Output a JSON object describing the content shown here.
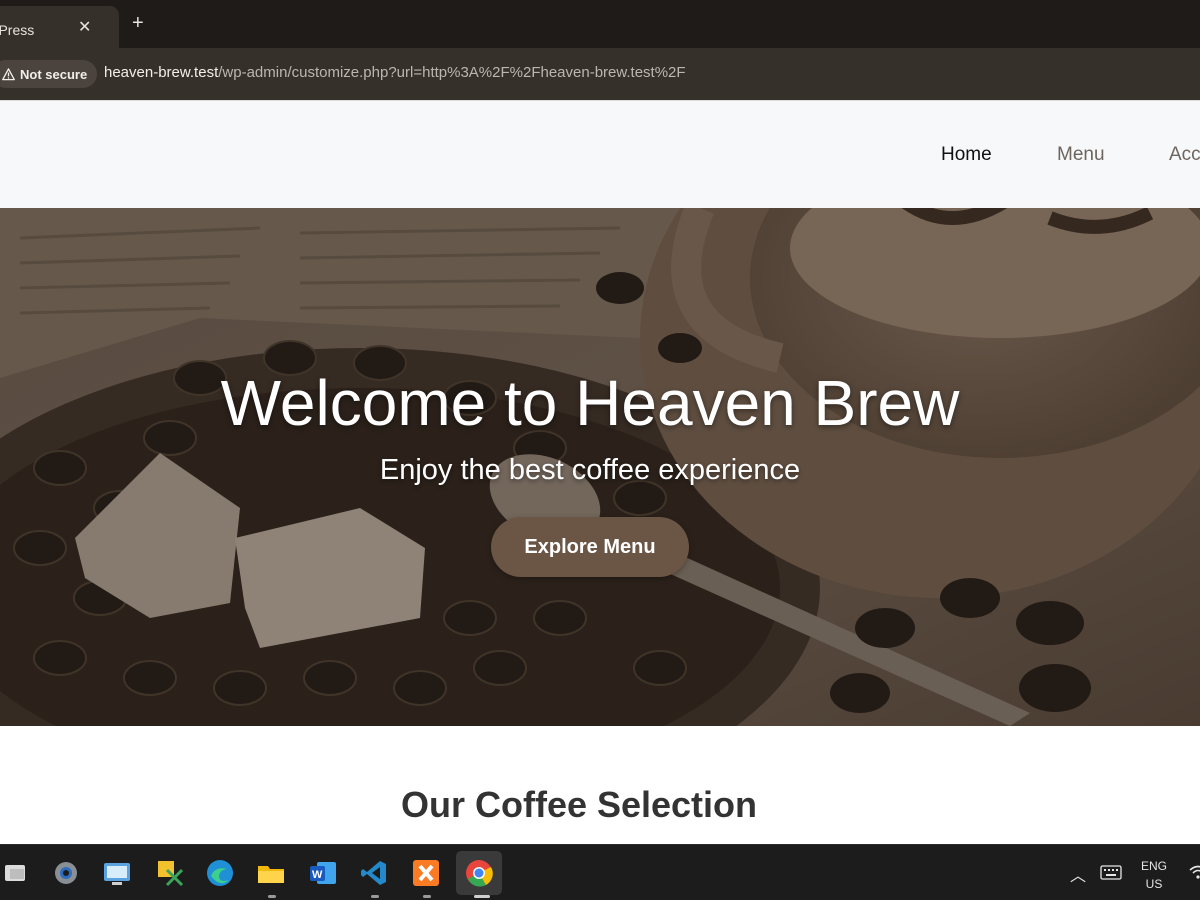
{
  "browser": {
    "tab": {
      "title": "rdPress",
      "close_glyph": "✕"
    },
    "new_tab_glyph": "+",
    "security_chip": "Not secure",
    "url": {
      "host": "heaven-brew.test",
      "path": "/wp-admin/customize.php?url=http%3A%2F%2Fheaven-brew.test%2F"
    }
  },
  "site": {
    "nav": [
      {
        "label": "Home",
        "active": true
      },
      {
        "label": "Menu",
        "active": false
      },
      {
        "label": "Acc",
        "active": false
      }
    ],
    "hero": {
      "title": "Welcome to Heaven Brew",
      "subtitle": "Enjoy the best coffee experience",
      "button": "Explore Menu"
    },
    "section_title": "Our Coffee Selection"
  },
  "taskbar": {
    "apps": [
      "task-view-icon",
      "settings-icon",
      "remote-desktop-icon",
      "snipping-tool-icon",
      "edge-icon",
      "file-explorer-icon",
      "word-icon",
      "vscode-icon",
      "xampp-icon",
      "chrome-icon"
    ],
    "tray": {
      "chevron_glyph": "︿",
      "lang_line1": "ENG",
      "lang_line2": "US"
    }
  },
  "colors": {
    "tabbar": "#1f1b18",
    "addressbar": "#36302b",
    "hero_button": "#6b5646",
    "site_header": "#f7f8fa",
    "taskbar": "#1c1c1c"
  }
}
